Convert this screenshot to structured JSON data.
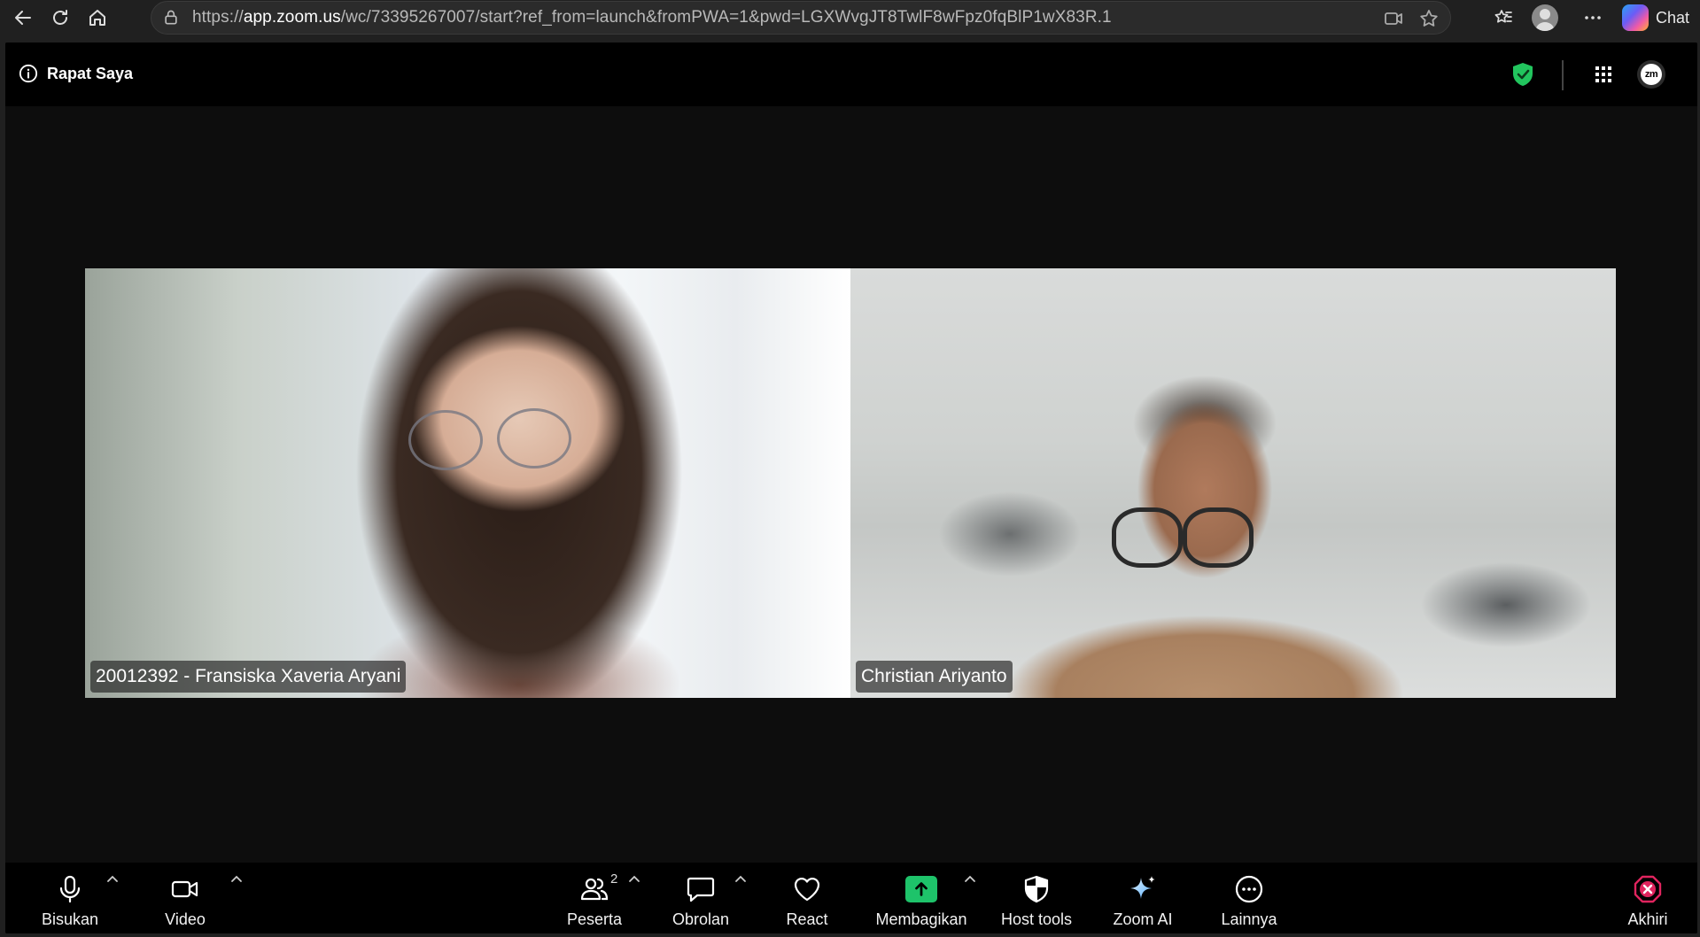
{
  "browser": {
    "url_prefix": "https://",
    "url_host": "app.zoom.us",
    "url_rest": "/wc/73395267007/start?ref_from=launch&fromPWA=1&pwd=LGXWvgJT8TwlF8wFpz0fqBlP1wX83R.1",
    "chat_label": "Chat"
  },
  "header": {
    "meeting_title": "Rapat Saya"
  },
  "participants": [
    {
      "name": "20012392 - Fransiska Xaveria Aryani"
    },
    {
      "name": "Christian Ariyanto"
    }
  ],
  "zoom_badge": "zm",
  "toolbar": {
    "mute_label": "Bisukan",
    "video_label": "Video",
    "participants_label": "Peserta",
    "participants_count": "2",
    "chat_label": "Obrolan",
    "react_label": "React",
    "share_label": "Membagikan",
    "host_tools_label": "Host tools",
    "zoom_ai_label": "Zoom AI",
    "more_label": "Lainnya",
    "end_label": "Akhiri"
  },
  "colors": {
    "share_green": "#1ec36a",
    "end_red": "#e0245e",
    "shield_green": "#22c55e"
  }
}
